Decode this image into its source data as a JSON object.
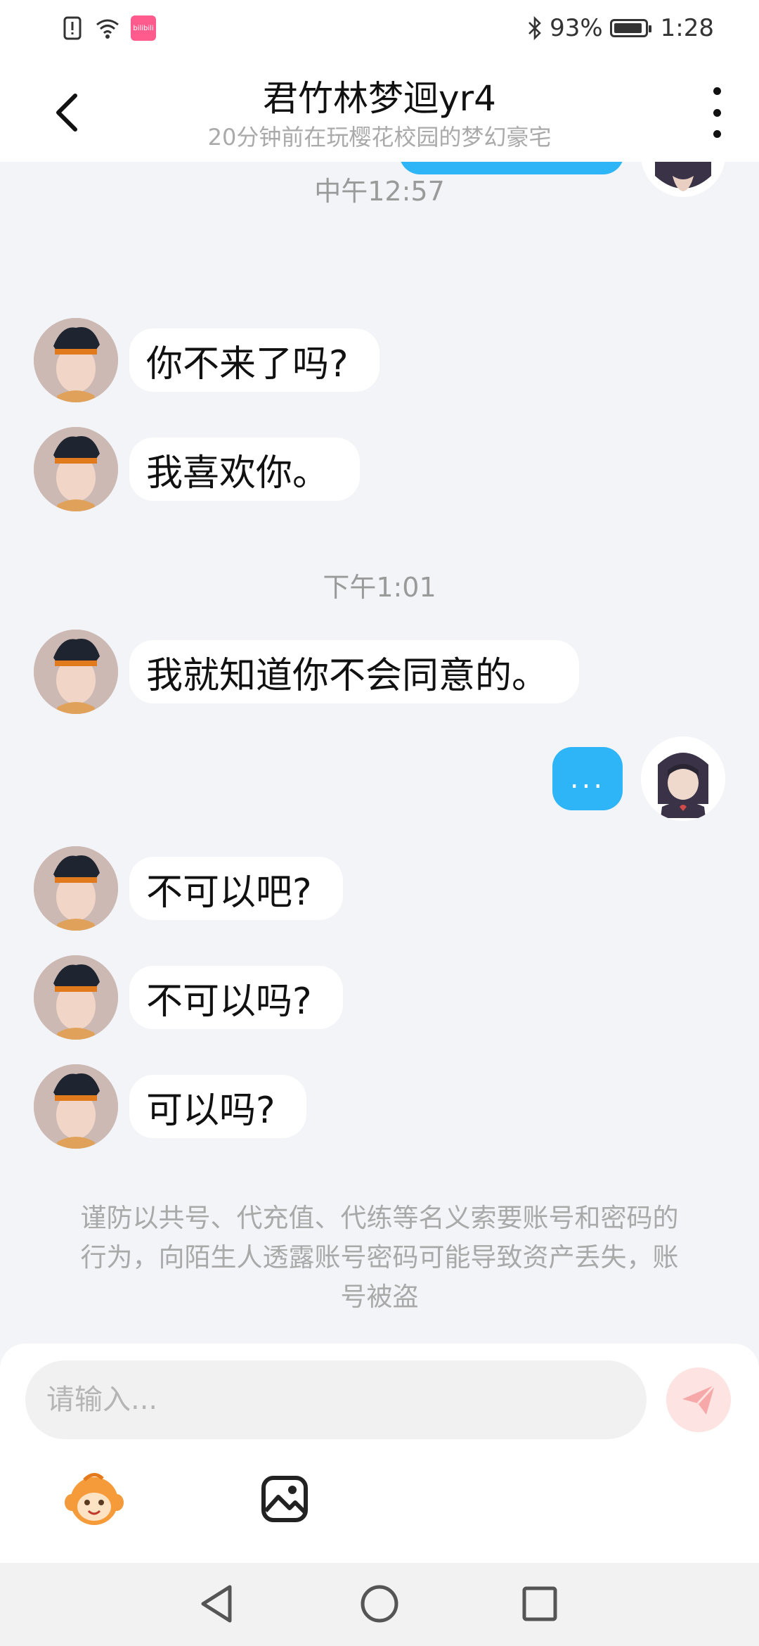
{
  "status_bar": {
    "app_badge_text": "bilibili",
    "battery_text": "93%",
    "battery_level": 0.93,
    "time": "1:28"
  },
  "header": {
    "title": "君竹林梦迴yr4",
    "subtitle": "20分钟前在玩樱花校园的梦幻豪宅"
  },
  "messages": {
    "ts1": "中午12:57",
    "m1": "你不来了吗?",
    "m2": "我喜欢你。",
    "ts2": "下午1:01",
    "m3": "我就知道你不会同意的。",
    "out1": "...",
    "m4": "不可以吧?",
    "m5": "不可以吗?",
    "m6": "可以吗?"
  },
  "warning": "谨防以共号、代充值、代练等名义索要账号和密码的行为，向陌生人透露账号密码可能导致资产丢失，账号被盗",
  "input": {
    "placeholder": "请输入..."
  },
  "colors": {
    "outgoing_bubble": "#2db5f8",
    "send_button_bg": "#fde3e1",
    "send_icon": "#f7a8a8",
    "background": "#f3f4f8"
  },
  "icons": [
    "back-arrow-icon",
    "more-vertical-icon",
    "send-icon",
    "emoji-icon",
    "image-icon",
    "nav-back-icon",
    "nav-home-icon",
    "nav-recents-icon"
  ]
}
